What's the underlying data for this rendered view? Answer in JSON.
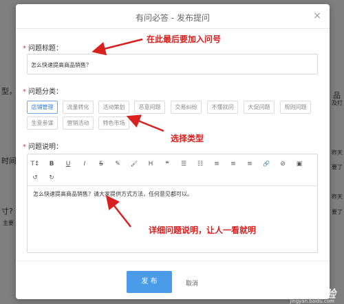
{
  "background": {
    "left_fragments": [
      "型，补",
      "时间的",
      "寸?",
      "主要"
    ],
    "right_fragments": [
      "品",
      "及打",
      "昨天",
      "要了",
      "昨天",
      "要了"
    ]
  },
  "modal": {
    "title": "有问必答 - 发布提问",
    "close": "×"
  },
  "form": {
    "title_label": "问题标题：",
    "title_value": "怎么快速提高商品销售？",
    "category_label": "问题分类：",
    "categories": [
      "店铺管理",
      "流量转化",
      "活动策划",
      "恶意问题",
      "交易纠纷",
      "不懂就问",
      "大促问题",
      "规则问题",
      "生意参谋",
      "营销活动",
      "特色市场"
    ],
    "selected_category": "店铺管理",
    "description_label": "问题说明：",
    "description_text": "怎么快速提高商品销售？请大家提供方式方法，任何意见都可以。",
    "required_mark": "*"
  },
  "toolbar": {
    "row1": [
      "T↕",
      "B",
      "U",
      "I",
      "S",
      "✎",
      "🖌",
      "H",
      "❝",
      "☰",
      "☷",
      "≡",
      "≡",
      "≡",
      "🔗",
      "⊘",
      "▣"
    ],
    "row1_names": [
      "font-size-icon",
      "bold-icon",
      "underline-icon",
      "italic-icon",
      "strikethrough-icon",
      "pencil-icon",
      "brush-icon",
      "heading-icon",
      "quote-icon",
      "bullet-list-icon",
      "ordered-list-icon",
      "align-left-icon",
      "align-center-icon",
      "align-right-icon",
      "link-icon",
      "unlink-icon",
      "image-icon"
    ],
    "row2": [
      "↺",
      "↻"
    ],
    "row2_names": [
      "undo-icon",
      "redo-icon"
    ]
  },
  "footer": {
    "publish": "发 布",
    "cancel": "取消"
  },
  "annotations": {
    "title_note": "在此最后要加入问号",
    "category_note": "选择类型",
    "description_note": "详细问题说明，让人一看就明"
  },
  "watermark": {
    "brand": "Baidu 经验",
    "url": "jingyan.baidu.com"
  },
  "colors": {
    "accent": "#4a9be8",
    "annotation_red": "#d8201f",
    "required_red": "#e4393c"
  }
}
